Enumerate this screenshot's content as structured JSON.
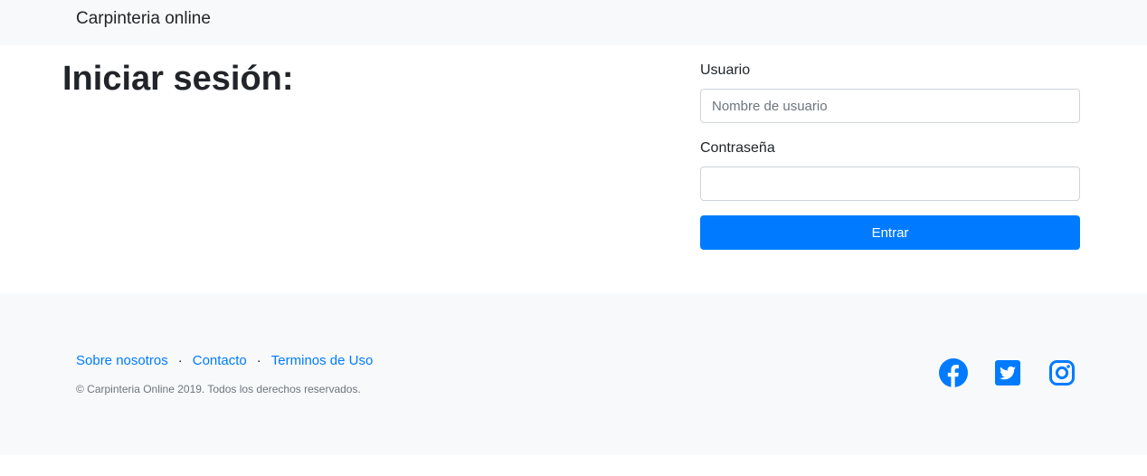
{
  "navbar": {
    "brand": "Carpinteria online"
  },
  "main": {
    "title": "Iniciar sesión:"
  },
  "login_form": {
    "username_label": "Usuario",
    "username_placeholder": "Nombre de usuario",
    "username_value": "",
    "password_label": "Contraseña",
    "password_value": "",
    "submit_label": "Entrar"
  },
  "footer": {
    "links": [
      {
        "label": "Sobre nosotros"
      },
      {
        "label": "Contacto"
      },
      {
        "label": "Terminos de Uso"
      }
    ],
    "separator": "·",
    "copyright": "© Carpinteria Online 2019. Todos los derechos reservados.",
    "social": [
      {
        "icon": "facebook-icon"
      },
      {
        "icon": "twitter-icon"
      },
      {
        "icon": "instagram-icon"
      }
    ]
  },
  "colors": {
    "accent": "#007bff",
    "navbar_bg": "#f8f9fa",
    "footer_bg": "#f8f9fa",
    "text": "#212529",
    "muted": "#6c757d"
  }
}
